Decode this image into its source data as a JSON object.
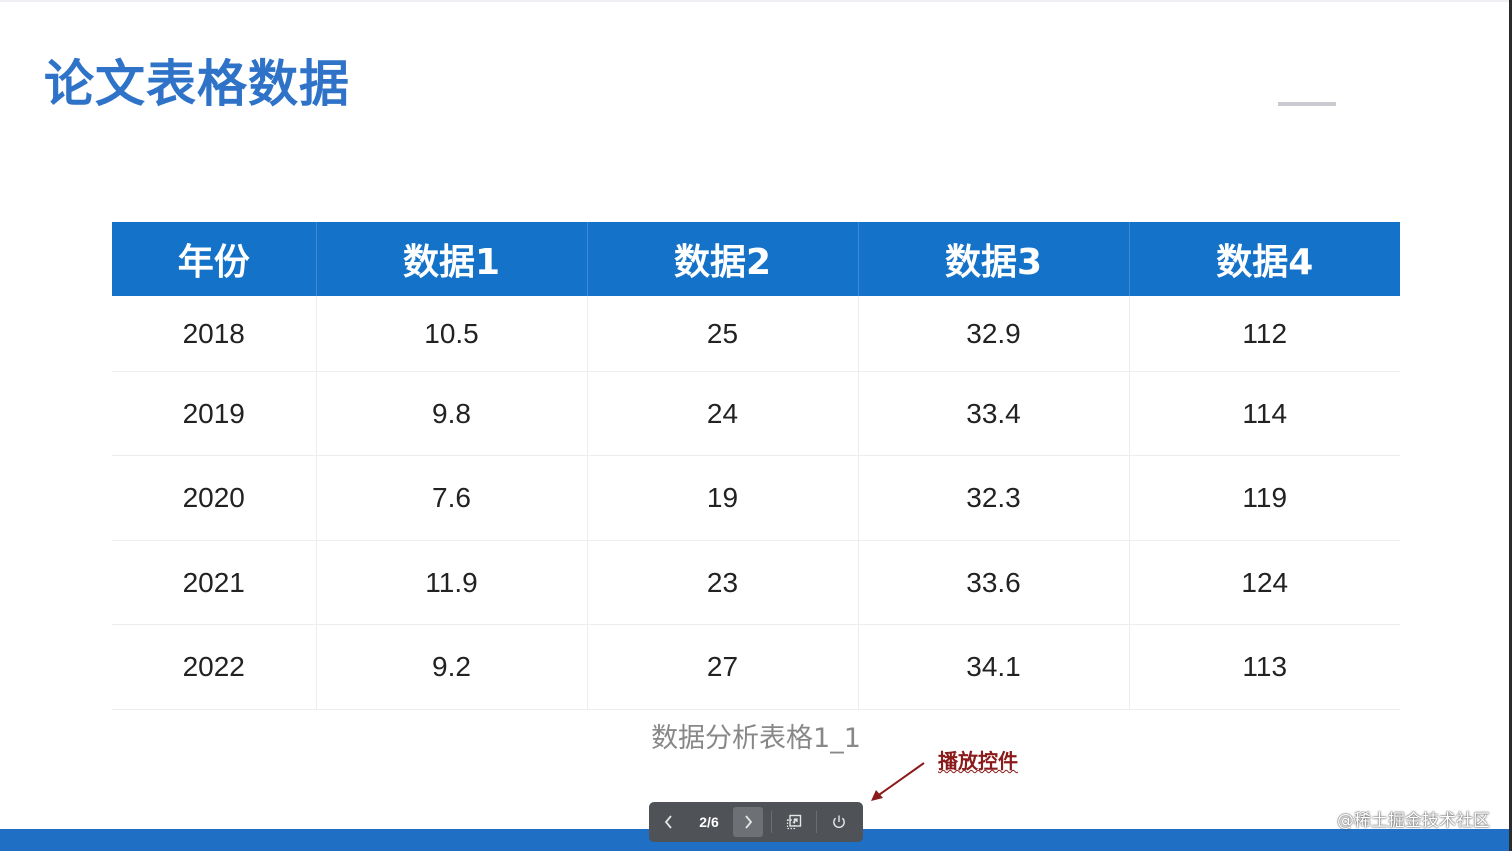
{
  "slide": {
    "title": "论文表格数据",
    "caption": "数据分析表格1_1"
  },
  "table": {
    "headers": [
      "年份",
      "数据1",
      "数据2",
      "数据3",
      "数据4"
    ],
    "rows": [
      [
        "2018",
        "10.5",
        "25",
        "32.9",
        "112"
      ],
      [
        "2019",
        "9.8",
        "24",
        "33.4",
        "114"
      ],
      [
        "2020",
        "7.6",
        "19",
        "32.3",
        "119"
      ],
      [
        "2021",
        "11.9",
        "23",
        "33.6",
        "124"
      ],
      [
        "2022",
        "9.2",
        "27",
        "34.1",
        "113"
      ]
    ]
  },
  "annotation": {
    "label": "播放控件"
  },
  "player": {
    "page": "2/6",
    "icons": [
      "chevron-left-icon",
      "chevron-right-icon",
      "fullscreen-icon",
      "power-icon"
    ]
  },
  "watermark": "@稀土掘金技术社区",
  "colors": {
    "title": "#2f73c9",
    "header_bg": "#1472c9",
    "bottom_bar": "#1f6fc4",
    "player_bg": "#4f5256",
    "annotation": "#8b1a1a"
  }
}
